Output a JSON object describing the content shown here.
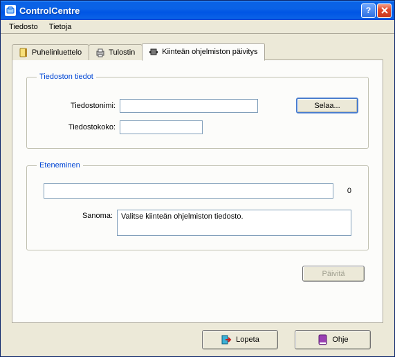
{
  "window": {
    "title": "ControlCentre"
  },
  "menu": {
    "file": "Tiedosto",
    "about": "Tietoja"
  },
  "tabs": {
    "phonebook": "Puhelinluettelo",
    "printer": "Tulostin",
    "firmware": "Kiinteän ohjelmiston päivitys"
  },
  "fileinfo": {
    "legend": "Tiedoston tiedot",
    "filename_label": "Tiedostonimi:",
    "filename_value": "",
    "filesize_label": "Tiedostokoko:",
    "filesize_value": "",
    "browse": "Selaa..."
  },
  "progress": {
    "legend": "Eteneminen",
    "value": "0",
    "message_label": "Sanoma:",
    "message_text": "Valitse kiinteän ohjelmiston tiedosto."
  },
  "buttons": {
    "update": "Päivitä",
    "quit": "Lopeta",
    "help": "Ohje"
  }
}
